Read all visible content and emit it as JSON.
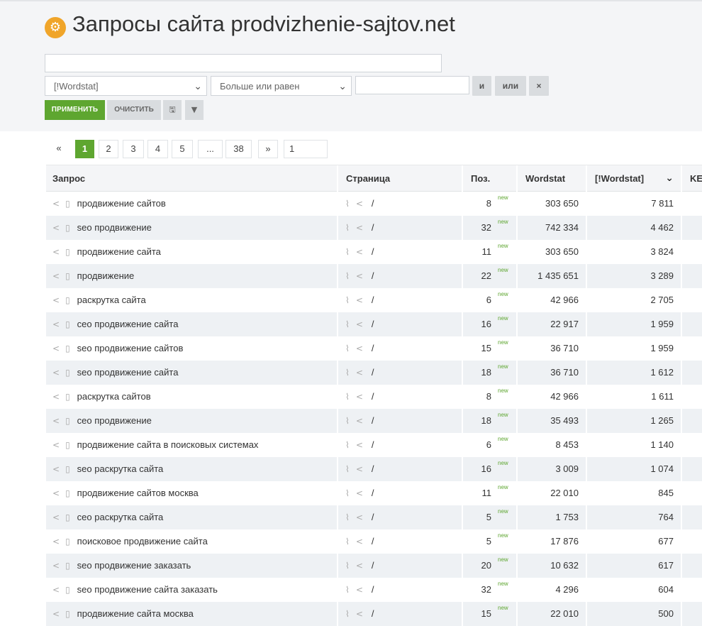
{
  "header": {
    "title": "Запросы сайта prodvizhenie-sajtov.net",
    "title_icon": "gear-icon"
  },
  "filter": {
    "query_value": "",
    "field_select": "[!Wordstat]",
    "operator_select": "Больше или равен",
    "value_input": "",
    "and_label": "и",
    "or_label": "или",
    "remove_label": "×",
    "apply_label": "ПРИМЕНИТЬ",
    "clear_label": "ОЧИСТИТЬ",
    "save_icon": "save-icon",
    "filter_icon": "filter-icon"
  },
  "pagination": {
    "prev": "«",
    "pages": [
      "1",
      "2",
      "3",
      "4",
      "5",
      "...",
      "38"
    ],
    "next": "»",
    "current": "1",
    "goto_value": "1"
  },
  "table": {
    "columns": [
      "Запрос",
      "Страница",
      "Поз.",
      "Wordstat",
      "[!Wordstat]",
      "KE"
    ],
    "new_label": "new",
    "page_path": "/",
    "rows": [
      {
        "query": "продвижение сайтов",
        "pos": "8",
        "wordstat": "303 650",
        "exact": "7 811"
      },
      {
        "query": "seo продвижение",
        "pos": "32",
        "wordstat": "742 334",
        "exact": "4 462"
      },
      {
        "query": "продвижение сайта",
        "pos": "11",
        "wordstat": "303 650",
        "exact": "3 824"
      },
      {
        "query": "продвижение",
        "pos": "22",
        "wordstat": "1 435 651",
        "exact": "3 289"
      },
      {
        "query": "раскрутка сайта",
        "pos": "6",
        "wordstat": "42 966",
        "exact": "2 705"
      },
      {
        "query": "сео продвижение сайта",
        "pos": "16",
        "wordstat": "22 917",
        "exact": "1 959"
      },
      {
        "query": "seo продвижение сайтов",
        "pos": "15",
        "wordstat": "36 710",
        "exact": "1 959"
      },
      {
        "query": "seo продвижение сайта",
        "pos": "18",
        "wordstat": "36 710",
        "exact": "1 612"
      },
      {
        "query": "раскрутка сайтов",
        "pos": "8",
        "wordstat": "42 966",
        "exact": "1 611"
      },
      {
        "query": "сео продвижение",
        "pos": "18",
        "wordstat": "35 493",
        "exact": "1 265"
      },
      {
        "query": "продвижение сайта в поисковых системах",
        "pos": "6",
        "wordstat": "8 453",
        "exact": "1 140"
      },
      {
        "query": "seo раскрутка сайта",
        "pos": "16",
        "wordstat": "3 009",
        "exact": "1 074"
      },
      {
        "query": "продвижение сайтов москва",
        "pos": "11",
        "wordstat": "22 010",
        "exact": "845"
      },
      {
        "query": "сео раскрутка сайта",
        "pos": "5",
        "wordstat": "1 753",
        "exact": "764"
      },
      {
        "query": "поисковое продвижение сайта",
        "pos": "5",
        "wordstat": "17 876",
        "exact": "677"
      },
      {
        "query": "seo продвижение заказать",
        "pos": "20",
        "wordstat": "10 632",
        "exact": "617"
      },
      {
        "query": "seo продвижение сайта заказать",
        "pos": "32",
        "wordstat": "4 296",
        "exact": "604"
      },
      {
        "query": "продвижение сайта москва",
        "pos": "15",
        "wordstat": "22 010",
        "exact": "500"
      }
    ]
  },
  "colors": {
    "accent_green": "#5ea630",
    "title_icon_orange": "#f0a52a",
    "panel_bg": "#f4f5f7",
    "row_alt_bg": "#eef1f4"
  }
}
